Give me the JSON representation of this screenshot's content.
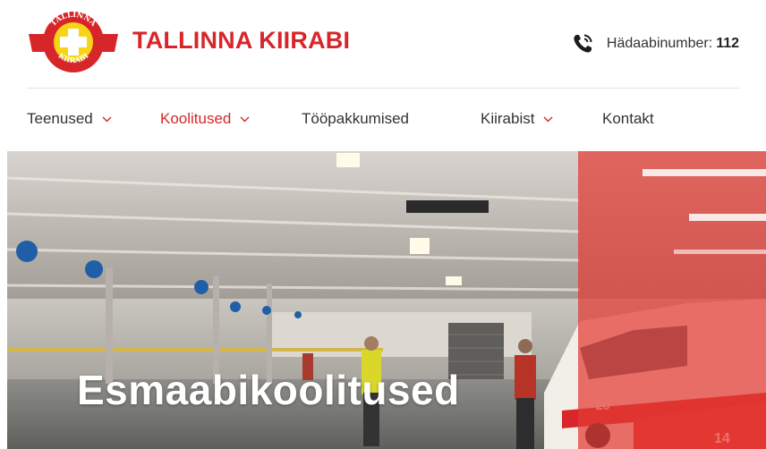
{
  "header": {
    "logo": {
      "ring_text_top": "TALLINNA",
      "ring_text_bottom": "KIIRABI"
    },
    "brand_name": "TALLINNA KIIRABI",
    "emergency": {
      "label": "Hädaabinumber:",
      "number": "112",
      "icon": "phone-icon"
    }
  },
  "nav": {
    "items": [
      {
        "label": "Teenused",
        "has_dropdown": true,
        "active": false
      },
      {
        "label": "Koolitused",
        "has_dropdown": true,
        "active": true
      },
      {
        "label": "Tööpakkumised",
        "has_dropdown": false,
        "active": false
      },
      {
        "label": "Kiirabist",
        "has_dropdown": true,
        "active": false
      },
      {
        "label": "Kontakt",
        "has_dropdown": false,
        "active": false
      }
    ]
  },
  "hero": {
    "title": "Esmaabikoolitused",
    "ambulance_numbers": [
      "20",
      "14"
    ]
  },
  "colors": {
    "brand_red": "#d7262a",
    "accent_yellow": "#f7d417",
    "text": "#333333"
  }
}
